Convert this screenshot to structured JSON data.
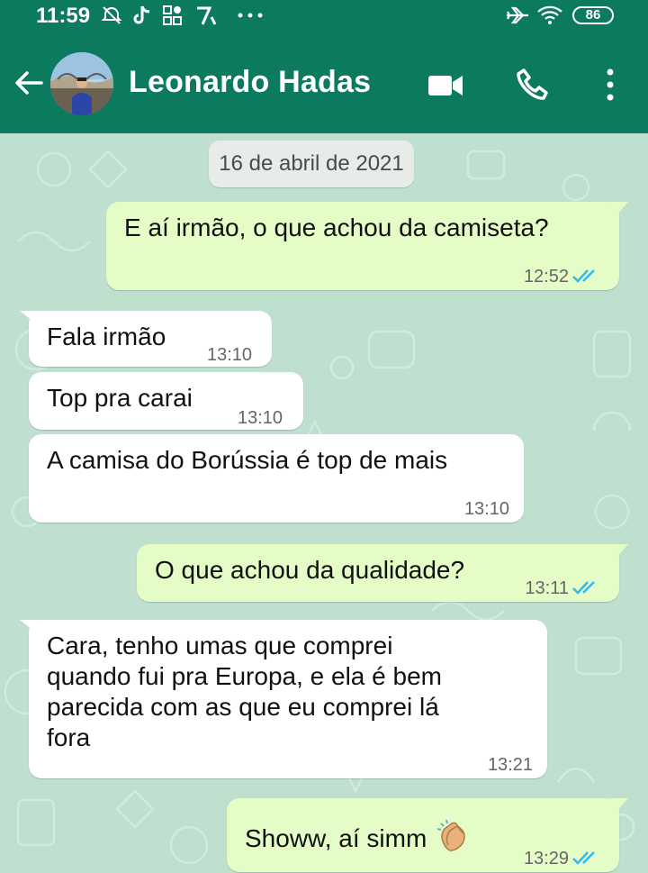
{
  "status_bar": {
    "time": "11:59",
    "battery": "86",
    "icons": [
      "alarm-off-icon",
      "tiktok-icon",
      "apps-grid-icon",
      "app-7-icon",
      "more-dots-icon",
      "airplane-icon",
      "wifi-icon",
      "battery-icon"
    ]
  },
  "app_bar": {
    "contact_name": "Leonardo Hadas",
    "icons": [
      "back-arrow-icon",
      "video-call-icon",
      "phone-icon",
      "more-vert-icon"
    ],
    "color": "#0b7a5e"
  },
  "chat": {
    "date_chip": "16 de abril de 2021",
    "messages": [
      {
        "direction": "out",
        "text": "E aí irmão, o que achou da camiseta?",
        "time": "12:52",
        "status": "read"
      },
      {
        "direction": "in",
        "text": "Fala irmão",
        "time": "13:10"
      },
      {
        "direction": "in",
        "text": "Top pra carai",
        "time": "13:10"
      },
      {
        "direction": "in",
        "text": "A camisa do Borússia é top de mais",
        "time": "13:10"
      },
      {
        "direction": "out",
        "text": "O que achou da qualidade?",
        "time": "13:11",
        "status": "read"
      },
      {
        "direction": "in",
        "text": "Cara, tenho umas que comprei\nquando fui pra Europa, e ela é bem\nparecida com as que eu comprei lá\nfora",
        "time": "13:21"
      },
      {
        "direction": "out",
        "text": "Showw, aí simm",
        "emoji": "clapping-hands-icon",
        "time": "13:29",
        "status": "read"
      }
    ],
    "colors": {
      "incoming": "#ffffff",
      "outgoing": "#e4fcc6",
      "read_ticks": "#34b7f1",
      "wallpaper": "#bfe0cf"
    }
  }
}
